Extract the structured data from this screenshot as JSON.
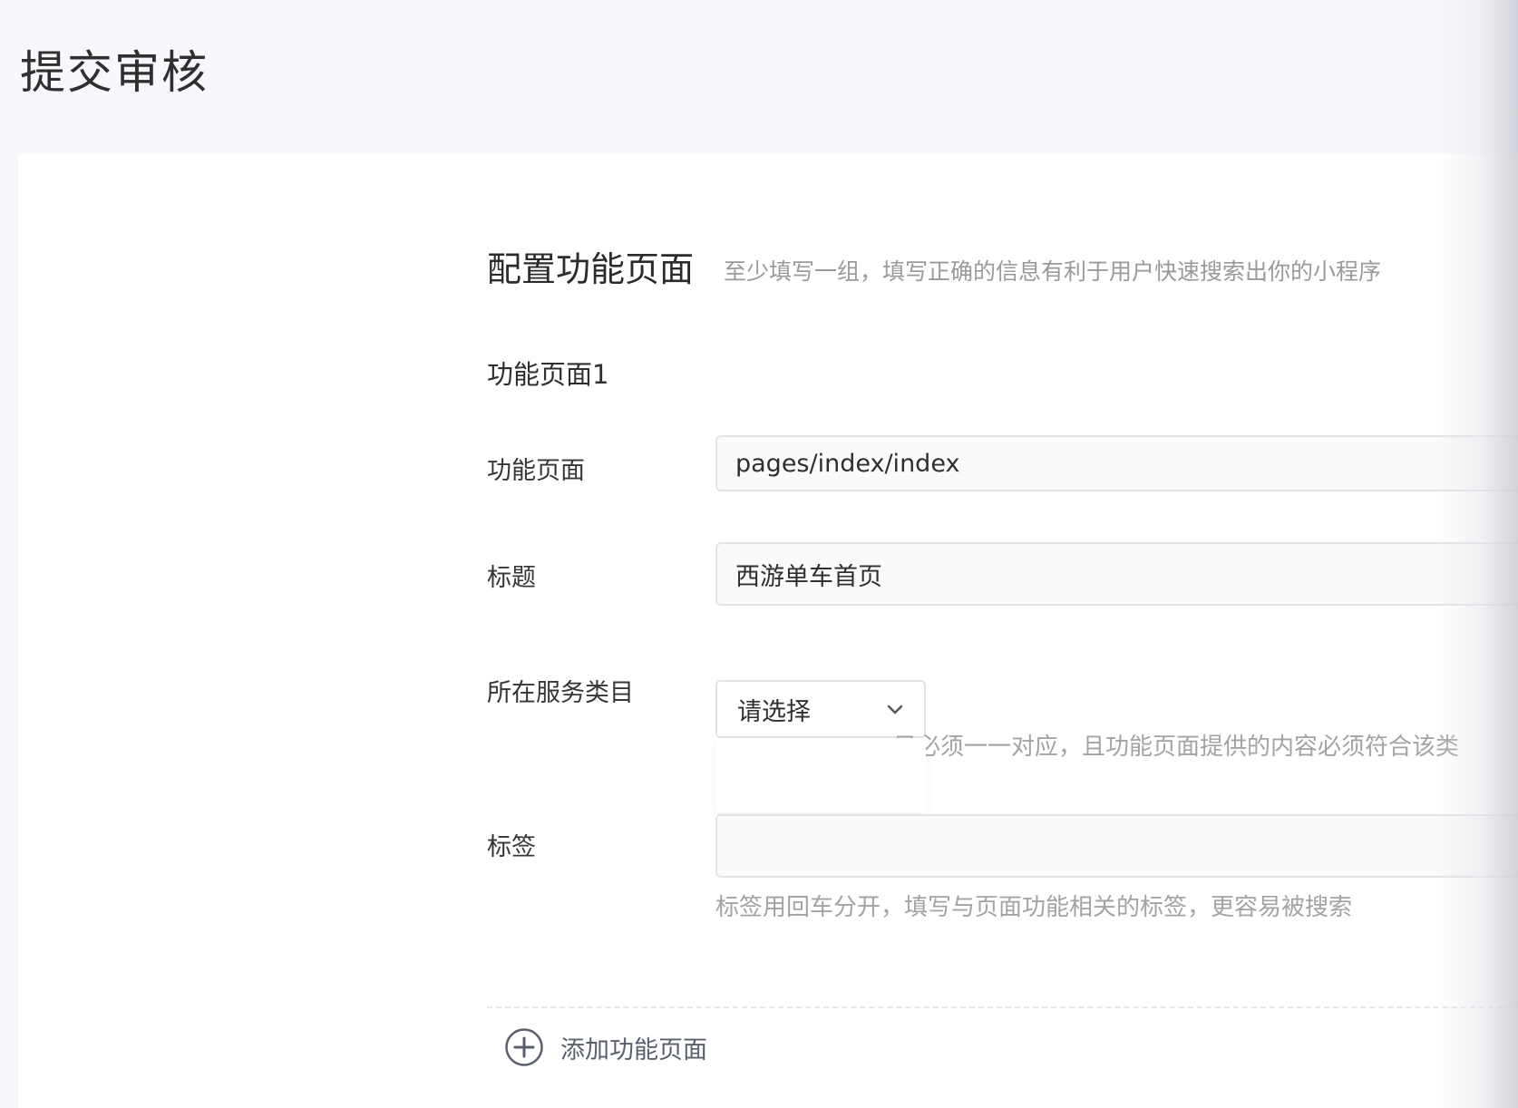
{
  "page": {
    "title": "提交审核"
  },
  "section": {
    "title": "配置功能页面",
    "description": "至少填写一组，填写正确的信息有利于用户快速搜索出你的小程序"
  },
  "group": {
    "title": "功能页面1"
  },
  "fields": {
    "page_path": {
      "label": "功能页面",
      "value": "pages/index/index"
    },
    "title": {
      "label": "标题",
      "value": "西游单车首页"
    },
    "category": {
      "label": "所在服务类目",
      "selected": "请选择",
      "hint": "目必须一一对应，且功能页面提供的内容必须符合该类"
    },
    "tags": {
      "label": "标签",
      "value": "",
      "hint": "标签用回车分开，填写与页面功能相关的标签，更容易被搜索"
    }
  },
  "actions": {
    "add_page_label": "添加功能页面"
  },
  "icons": {
    "select": "chevron-down-icon",
    "add": "plus-circle-icon"
  },
  "colors": {
    "background": "#f7f8fc",
    "card": "#ffffff",
    "hint": "#a3a3a3"
  }
}
